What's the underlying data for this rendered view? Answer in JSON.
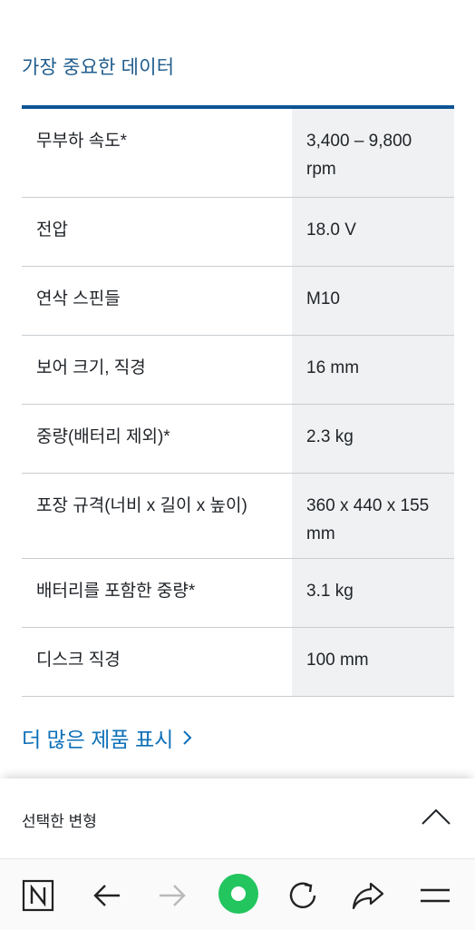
{
  "section": {
    "title": "가장 중요한 데이터"
  },
  "specs": [
    {
      "label": "무부하 속도*",
      "value": "3,400 – 9,800 rpm"
    },
    {
      "label": "전압",
      "value": "18.0 V"
    },
    {
      "label": "연삭 스핀들",
      "value": "M10"
    },
    {
      "label": "보어 크기, 직경",
      "value": "16 mm"
    },
    {
      "label": "중량(배터리 제외)*",
      "value": "2.3 kg"
    },
    {
      "label": "포장 규격(너비 x 길이 x 높이)",
      "value": "360 x 440 x 155 mm"
    },
    {
      "label": "배터리를 포함한 중량*",
      "value": "3.1 kg"
    },
    {
      "label": "디스크 직경",
      "value": "100 mm"
    }
  ],
  "more_link": {
    "label": "더 많은 제품 표시"
  },
  "variant": {
    "label": "선택한 변형",
    "toggle_icon": "chevron-up-icon"
  },
  "colors": {
    "accent": "#0e70b8",
    "table_rule": "#0d5494",
    "title": "#1f5c8d",
    "value_bg": "#eff1f2",
    "browser_green": "#22c55e"
  },
  "browser_nav": {
    "icons": [
      "naver-n-icon",
      "back-arrow-icon",
      "forward-arrow-icon",
      "green-dot-icon",
      "reload-icon",
      "share-icon",
      "menu-icon"
    ]
  }
}
